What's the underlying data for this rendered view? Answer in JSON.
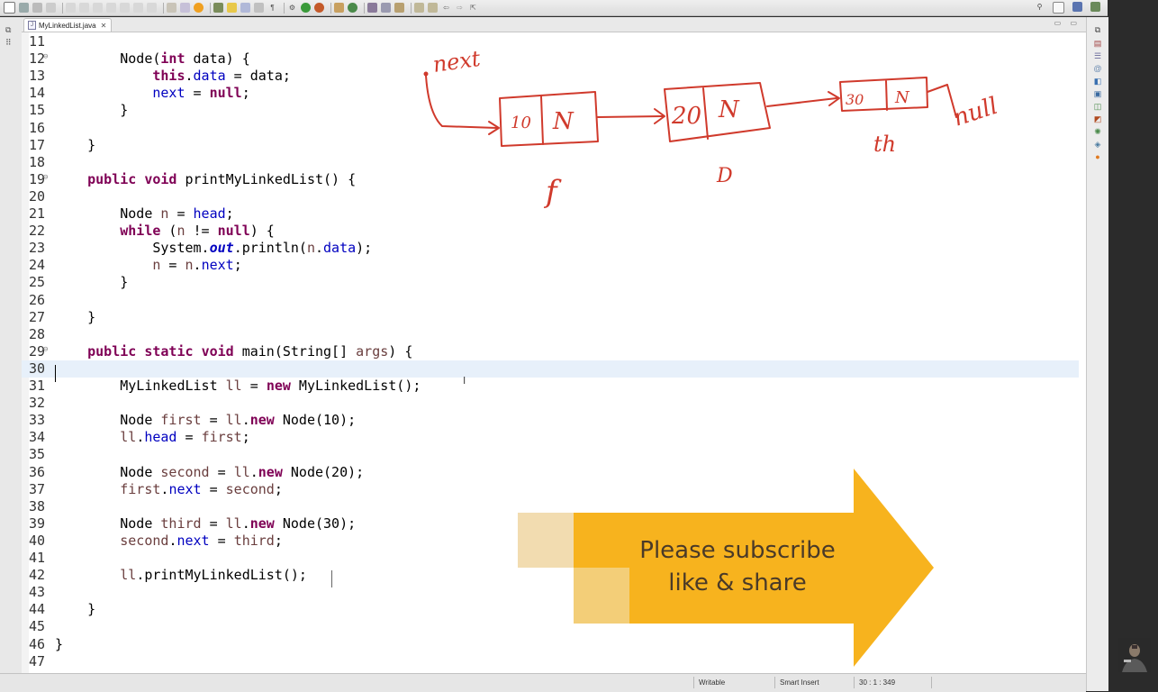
{
  "editor_tab": {
    "filename": "MyLinkedList.java",
    "close_glyph": "✕"
  },
  "tab_controls": "▭ ▭",
  "code_lines": [
    {
      "n": "11",
      "fold": false,
      "current": false,
      "tokens": []
    },
    {
      "n": "12",
      "fold": true,
      "current": false,
      "tokens": [
        {
          "t": "        Node("
        },
        {
          "t": "int",
          "c": "kw"
        },
        {
          "t": " data) {"
        }
      ]
    },
    {
      "n": "13",
      "fold": false,
      "current": false,
      "tokens": [
        {
          "t": "            "
        },
        {
          "t": "this",
          "c": "kw"
        },
        {
          "t": "."
        },
        {
          "t": "data",
          "c": "fld"
        },
        {
          "t": " = data;"
        }
      ]
    },
    {
      "n": "14",
      "fold": false,
      "current": false,
      "tokens": [
        {
          "t": "            "
        },
        {
          "t": "next",
          "c": "fld"
        },
        {
          "t": " = "
        },
        {
          "t": "null",
          "c": "kw"
        },
        {
          "t": ";"
        }
      ]
    },
    {
      "n": "15",
      "fold": false,
      "current": false,
      "tokens": [
        {
          "t": "        }"
        }
      ]
    },
    {
      "n": "16",
      "fold": false,
      "current": false,
      "tokens": []
    },
    {
      "n": "17",
      "fold": false,
      "current": false,
      "tokens": [
        {
          "t": "    }"
        }
      ]
    },
    {
      "n": "18",
      "fold": false,
      "current": false,
      "tokens": []
    },
    {
      "n": "19",
      "fold": true,
      "current": false,
      "tokens": [
        {
          "t": "    "
        },
        {
          "t": "public",
          "c": "kw"
        },
        {
          "t": " "
        },
        {
          "t": "void",
          "c": "kw"
        },
        {
          "t": " printMyLinkedList() {"
        }
      ]
    },
    {
      "n": "20",
      "fold": false,
      "current": false,
      "tokens": []
    },
    {
      "n": "21",
      "fold": false,
      "current": false,
      "tokens": [
        {
          "t": "        Node "
        },
        {
          "t": "n",
          "c": "var"
        },
        {
          "t": " = "
        },
        {
          "t": "head",
          "c": "fld"
        },
        {
          "t": ";"
        }
      ]
    },
    {
      "n": "22",
      "fold": false,
      "current": false,
      "tokens": [
        {
          "t": "        "
        },
        {
          "t": "while",
          "c": "kw"
        },
        {
          "t": " ("
        },
        {
          "t": "n",
          "c": "var"
        },
        {
          "t": " != "
        },
        {
          "t": "null",
          "c": "kw"
        },
        {
          "t": ") {"
        }
      ]
    },
    {
      "n": "23",
      "fold": false,
      "current": false,
      "tokens": [
        {
          "t": "            System."
        },
        {
          "t": "out",
          "c": "st"
        },
        {
          "t": ".println("
        },
        {
          "t": "n",
          "c": "var"
        },
        {
          "t": "."
        },
        {
          "t": "data",
          "c": "fld"
        },
        {
          "t": ");"
        }
      ]
    },
    {
      "n": "24",
      "fold": false,
      "current": false,
      "tokens": [
        {
          "t": "            "
        },
        {
          "t": "n",
          "c": "var"
        },
        {
          "t": " = "
        },
        {
          "t": "n",
          "c": "var"
        },
        {
          "t": "."
        },
        {
          "t": "next",
          "c": "fld"
        },
        {
          "t": ";"
        }
      ]
    },
    {
      "n": "25",
      "fold": false,
      "current": false,
      "tokens": [
        {
          "t": "        }"
        }
      ]
    },
    {
      "n": "26",
      "fold": false,
      "current": false,
      "tokens": []
    },
    {
      "n": "27",
      "fold": false,
      "current": false,
      "tokens": [
        {
          "t": "    }"
        }
      ]
    },
    {
      "n": "28",
      "fold": false,
      "current": false,
      "tokens": []
    },
    {
      "n": "29",
      "fold": true,
      "current": false,
      "tokens": [
        {
          "t": "    "
        },
        {
          "t": "public",
          "c": "kw"
        },
        {
          "t": " "
        },
        {
          "t": "static",
          "c": "kw"
        },
        {
          "t": " "
        },
        {
          "t": "void",
          "c": "kw"
        },
        {
          "t": " main(String[] "
        },
        {
          "t": "args",
          "c": "var"
        },
        {
          "t": ") {"
        }
      ]
    },
    {
      "n": "30",
      "fold": false,
      "current": true,
      "tokens": []
    },
    {
      "n": "31",
      "fold": false,
      "current": false,
      "tokens": [
        {
          "t": "        MyLinkedList "
        },
        {
          "t": "ll",
          "c": "var"
        },
        {
          "t": " = "
        },
        {
          "t": "new",
          "c": "kw"
        },
        {
          "t": " MyLinkedList();"
        }
      ]
    },
    {
      "n": "32",
      "fold": false,
      "current": false,
      "tokens": []
    },
    {
      "n": "33",
      "fold": false,
      "current": false,
      "tokens": [
        {
          "t": "        Node "
        },
        {
          "t": "first",
          "c": "var"
        },
        {
          "t": " = "
        },
        {
          "t": "ll",
          "c": "var"
        },
        {
          "t": "."
        },
        {
          "t": "new",
          "c": "kw"
        },
        {
          "t": " Node(10);"
        }
      ]
    },
    {
      "n": "34",
      "fold": false,
      "current": false,
      "tokens": [
        {
          "t": "        "
        },
        {
          "t": "ll",
          "c": "var"
        },
        {
          "t": "."
        },
        {
          "t": "head",
          "c": "fld"
        },
        {
          "t": " = "
        },
        {
          "t": "first",
          "c": "var"
        },
        {
          "t": ";"
        }
      ]
    },
    {
      "n": "35",
      "fold": false,
      "current": false,
      "tokens": []
    },
    {
      "n": "36",
      "fold": false,
      "current": false,
      "tokens": [
        {
          "t": "        Node "
        },
        {
          "t": "second",
          "c": "var"
        },
        {
          "t": " = "
        },
        {
          "t": "ll",
          "c": "var"
        },
        {
          "t": "."
        },
        {
          "t": "new",
          "c": "kw"
        },
        {
          "t": " Node(20);"
        }
      ]
    },
    {
      "n": "37",
      "fold": false,
      "current": false,
      "tokens": [
        {
          "t": "        "
        },
        {
          "t": "first",
          "c": "var"
        },
        {
          "t": "."
        },
        {
          "t": "next",
          "c": "fld"
        },
        {
          "t": " = "
        },
        {
          "t": "second",
          "c": "var"
        },
        {
          "t": ";"
        }
      ]
    },
    {
      "n": "38",
      "fold": false,
      "current": false,
      "tokens": []
    },
    {
      "n": "39",
      "fold": false,
      "current": false,
      "tokens": [
        {
          "t": "        Node "
        },
        {
          "t": "third",
          "c": "var"
        },
        {
          "t": " = "
        },
        {
          "t": "ll",
          "c": "var"
        },
        {
          "t": "."
        },
        {
          "t": "new",
          "c": "kw"
        },
        {
          "t": " Node(30);"
        }
      ]
    },
    {
      "n": "40",
      "fold": false,
      "current": false,
      "tokens": [
        {
          "t": "        "
        },
        {
          "t": "second",
          "c": "var"
        },
        {
          "t": "."
        },
        {
          "t": "next",
          "c": "fld"
        },
        {
          "t": " = "
        },
        {
          "t": "third",
          "c": "var"
        },
        {
          "t": ";"
        }
      ]
    },
    {
      "n": "41",
      "fold": false,
      "current": false,
      "tokens": []
    },
    {
      "n": "42",
      "fold": false,
      "current": false,
      "tokens": [
        {
          "t": "        "
        },
        {
          "t": "ll",
          "c": "var"
        },
        {
          "t": ".printMyLinkedList();"
        }
      ]
    },
    {
      "n": "43",
      "fold": false,
      "current": false,
      "tokens": []
    },
    {
      "n": "44",
      "fold": false,
      "current": false,
      "tokens": [
        {
          "t": "    }"
        }
      ]
    },
    {
      "n": "45",
      "fold": false,
      "current": false,
      "tokens": []
    },
    {
      "n": "46",
      "fold": false,
      "current": false,
      "tokens": [
        {
          "t": "}"
        }
      ]
    },
    {
      "n": "47",
      "fold": false,
      "current": false,
      "tokens": []
    }
  ],
  "drawing": {
    "color": "#d03a2c",
    "head_label": "next",
    "node1": {
      "data": "10",
      "next": "N",
      "label": "f"
    },
    "node2": {
      "data": "20",
      "next": "N",
      "label": "D"
    },
    "node3": {
      "data": "30",
      "next": "N",
      "label": "th"
    },
    "null_label": "null"
  },
  "banner": {
    "line1": "Please subscribe",
    "line2": "like & share",
    "color_main": "#f7b31e",
    "color_light": "#f2dcb0",
    "color_mid": "#f3ce78"
  },
  "status": {
    "writable": "Writable",
    "insert_mode": "Smart Insert",
    "position": "30 : 1 : 349"
  }
}
